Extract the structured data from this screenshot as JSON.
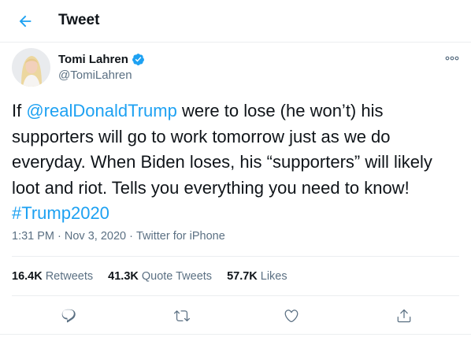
{
  "header": {
    "title": "Tweet",
    "back_icon": "arrow-left-icon"
  },
  "author": {
    "display_name": "Tomi Lahren",
    "handle": "@TomiLahren",
    "verified_icon": "verified-badge-icon",
    "more_icon": "more-horizontal-icon"
  },
  "tweet": {
    "text_before_mention": "If ",
    "mention": "@realDonaldTrump",
    "text_after_mention": " were to lose (he won’t) his supporters will go to work tomorrow just as we do everyday. When Biden loses, his “supporters” will likely loot and riot. Tells you everything you need to know! ",
    "hashtag": "#Trump2020"
  },
  "meta": {
    "time": "1:31 PM",
    "separator": " · ",
    "date": "Nov 3, 2020",
    "source": "Twitter for iPhone"
  },
  "stats": [
    {
      "count": "16.4K",
      "label": "Retweets"
    },
    {
      "count": "41.3K",
      "label": "Quote Tweets"
    },
    {
      "count": "57.7K",
      "label": "Likes"
    }
  ],
  "actions": [
    "reply-icon",
    "retweet-icon",
    "like-icon",
    "share-icon"
  ],
  "colors": {
    "accent": "#1da1f2",
    "text": "#0f1419",
    "secondary_text": "#5b7083",
    "border": "#ebeef0"
  }
}
